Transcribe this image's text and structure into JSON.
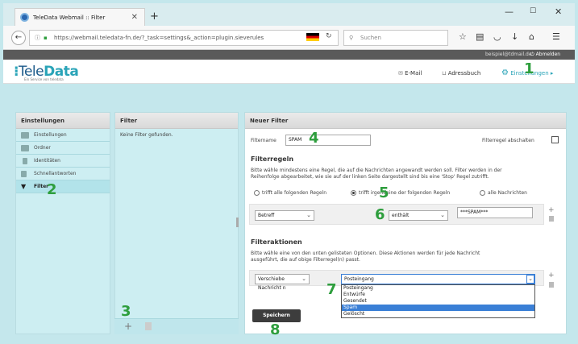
{
  "browser": {
    "tab_title": "TeleData Webmail :: Filter",
    "url": "https://webmail.teledata-fn.de/?_task=settings&_action=plugin.sieverules",
    "search_placeholder": "Suchen",
    "reload_icon": "↻"
  },
  "user": {
    "email": "beispiel@tdmail.de",
    "logout": "Abmelden"
  },
  "app": {
    "logo_a": "Tele",
    "logo_b": "Data",
    "logo_sub": "Ein Service von teledata"
  },
  "topnav": {
    "email": "E-Mail",
    "addressbook": "Adressbuch",
    "settings": "Einstellungen"
  },
  "settings_panel": {
    "title": "Einstellungen",
    "items": [
      {
        "label": "Einstellungen",
        "icon": "monitor-icon"
      },
      {
        "label": "Ordner",
        "icon": "folder-icon"
      },
      {
        "label": "Identitäten",
        "icon": "person-icon"
      },
      {
        "label": "Schnellantworten",
        "icon": "document-icon"
      },
      {
        "label": "Filter",
        "icon": "filter-icon"
      }
    ]
  },
  "filter_panel": {
    "title": "Filter",
    "empty_text": "Keine Filter gefunden.",
    "add_icon": "+",
    "delete_icon": "trash-icon"
  },
  "new_filter": {
    "title": "Neuer Filter",
    "name_label": "Filtername",
    "name_value": "SPAM",
    "disable_label": "Filterregel abschalten",
    "rules_heading": "Filterregeln",
    "rules_desc_1": "Bitte wähle mindestens eine Regel, die auf die Nachrichten angewandt werden soll. Filter werden in der",
    "rules_desc_2": "Reihenfolge abgearbeitet, wie sie auf der linken Seite dargestellt sind bis eine 'Stop' Regel zutrifft.",
    "radio_all": "trifft alle folgenden Regeln",
    "radio_any": "trifft irgendeine der folgenden Regeln",
    "radio_every": "alle Nachrichten",
    "rule_field": "Betreff",
    "rule_op": "enthält",
    "rule_value": "***SPAM***",
    "actions_heading": "Filteraktionen",
    "actions_desc_1": "Bitte wähle eine von den unten gelisteten Optionen. Diese Aktionen werden für jede Nachricht",
    "actions_desc_2": "ausgeführt, die auf obige Filterregel(n) passt.",
    "action_type": "Verschiebe Nachricht n",
    "action_target": "Posteingang",
    "folder_options": [
      "Posteingang",
      "Entwürfe",
      "Gesendet",
      "Spam",
      "Gelöscht"
    ],
    "selected_folder": "Spam",
    "save_label": "Speichern"
  },
  "step_numbers": {
    "n1": "1",
    "n2": "2",
    "n3": "3",
    "n4": "4",
    "n5": "5",
    "n6": "6",
    "n7": "7",
    "n8": "8"
  },
  "colors": {
    "accent": "#2e9e3d",
    "panel_bg": "#cdeef2",
    "page_bg": "#c4e7ec",
    "highlight": "#3a7fd6"
  }
}
